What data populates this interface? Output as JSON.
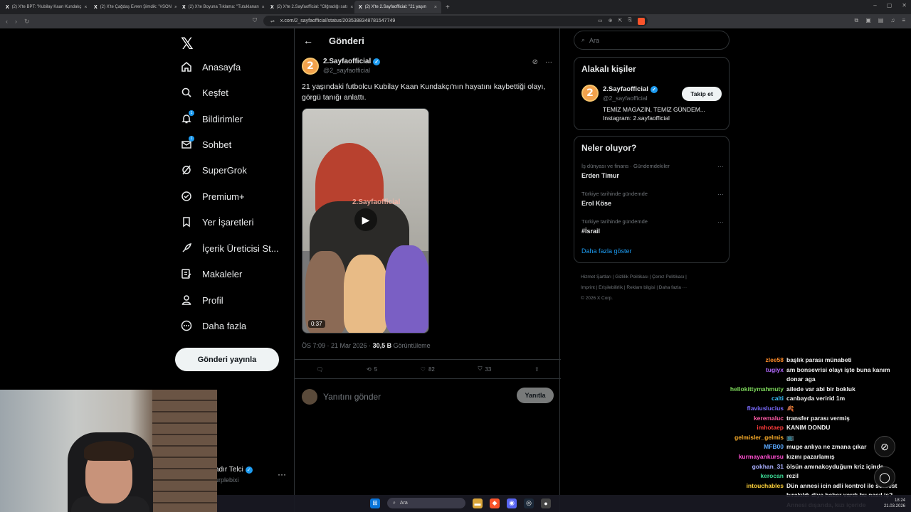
{
  "browser": {
    "tabs": [
      {
        "label": "(2) X'te BPT: \"Kubilay Kaan Kundakç",
        "active": false
      },
      {
        "label": "(2) X'te Çağdaş Evren Şimdik: \"#SON",
        "active": false
      },
      {
        "label": "(2) X'te Boyuna Tıklama: \"Tutuklanan",
        "active": false
      },
      {
        "label": "(2) X'te 2.Sayfaofficial: \"Olğradığı satı",
        "active": false
      },
      {
        "label": "(2) X'te 2.Sayfaofficial: \"21 yaşın",
        "active": true
      }
    ],
    "url": "x.com/2_sayfaofficial/status/2035388348781547749"
  },
  "nav": {
    "items": [
      {
        "label": "Anasayfa",
        "icon": "home-icon"
      },
      {
        "label": "Keşfet",
        "icon": "search-icon"
      },
      {
        "label": "Bildirimler",
        "icon": "bell-icon",
        "badge": "1"
      },
      {
        "label": "Sohbet",
        "icon": "mail-icon",
        "badge": "1"
      },
      {
        "label": "SuperGrok",
        "icon": "grok-icon"
      },
      {
        "label": "Premium+",
        "icon": "premium-icon"
      },
      {
        "label": "Yer İşaretleri",
        "icon": "bookmark-icon"
      },
      {
        "label": "İçerik Üreticisi St...",
        "icon": "rocket-icon"
      },
      {
        "label": "Makaleler",
        "icon": "article-icon"
      },
      {
        "label": "Profil",
        "icon": "person-icon"
      },
      {
        "label": "Daha fazla",
        "icon": "more-circle-icon"
      }
    ],
    "post_button": "Gönderi yayınla",
    "account_name": "adır Telci",
    "account_handle": "urplebixi"
  },
  "post": {
    "header_title": "Gönderi",
    "author": "2.Sayfaofficial",
    "handle": "@2_sayfaofficial",
    "avatar_text": "2",
    "text": "21 yaşındaki futbolcu Kubilay Kaan Kundakçı'nın hayatını kaybettiği olayı, görgü tanığı anlattı.",
    "video_watermark": "2.Sayfaofficial",
    "video_duration": "0:37",
    "time": "ÖS 7:09 · 21 Mar 2026 · ",
    "views": "30,5 B",
    "views_label": " Görüntüleme",
    "reposts": "5",
    "likes": "82",
    "bookmarks": "33",
    "reply_placeholder": "Yanıtını gönder",
    "reply_button": "Yanıtla"
  },
  "sidebar": {
    "search_placeholder": "Ara",
    "relevant_title": "Alakalı kişiler",
    "person_name": "2.Sayfaofficial",
    "person_handle": "@2_sayfaofficial",
    "follow": "Takip et",
    "bio_line1": "TEMİZ MAGAZİN, TEMİZ GÜNDEM...",
    "bio_line2": "Instagram: 2.sayfaofficial",
    "trends_title": "Neler oluyor?",
    "trends": [
      {
        "context": "İş dünyası ve finans · Gündemdekiler",
        "title": "Erden Timur"
      },
      {
        "context": "Türkiye tarihinde gündemde",
        "title": "Erol Köse"
      },
      {
        "context": "Türkiye tarihinde gündemde",
        "title": "#İsrail"
      }
    ],
    "show_more": "Daha fazla göster",
    "footer_line1": "Hizmet Şartları  |  Gizlilik Politikası  |  Çerez Politikası  |",
    "footer_line2": "Imprint  |  Erişilebilirlik  |  Reklam bilgisi  |  Daha fazla ···",
    "footer_line3": "© 2026 X Corp."
  },
  "chat": [
    {
      "user": "zlee58",
      "msg": "başlık parası münabeti",
      "color": "#ff8c2a"
    },
    {
      "user": "tugiyx",
      "msg": "am bonsevrisi olayı işte buna kanım",
      "color": "#b36bff"
    },
    {
      "user": "",
      "msg": "donar aga",
      "color": "#ffffff"
    },
    {
      "user": "hellokittymahmuty",
      "msg": "ailede var abi bir bokluk",
      "color": "#7cd65a"
    },
    {
      "user": "calti",
      "msg": "canbayda veririd 1m",
      "color": "#39c3ff"
    },
    {
      "user": "flaviuslucius",
      "msg": "🍂",
      "color": "#7a6bff"
    },
    {
      "user": "keremaluc",
      "msg": "transfer parası vermiş",
      "color": "#ff5aa6"
    },
    {
      "user": "imhotaep",
      "msg": "KANIM DONDU",
      "color": "#ff3b3b"
    },
    {
      "user": "gelmisler_gelmis",
      "msg": "📺",
      "color": "#ffb02a"
    },
    {
      "user": "MFB00",
      "msg": "muge anlıya ne zmana çıkar",
      "color": "#5aa9ff"
    },
    {
      "user": "kurmayankursu",
      "msg": "kızını pazarlamış",
      "color": "#ff4fd1"
    },
    {
      "user": "gokhan_31",
      "msg": "ölsün amınakoyduğum kriz içinde",
      "color": "#aab0ff"
    },
    {
      "user": "kerocan",
      "msg": "rezil",
      "color": "#3ddc97"
    },
    {
      "user": "intouchables",
      "msg": "Dün annesi icin adli kontrol ile serbest bırakıldı diye haber vardı bu nasıl iş? Annesi dışarıda, kızı içeride",
      "color": "#ffd23a"
    }
  ],
  "taskbar": {
    "search": "Ara",
    "time": "18:24",
    "date": "21.03.2026"
  },
  "colors": {
    "accent": "#1d9bf0",
    "background": "#000000",
    "border": "#2f3336"
  }
}
